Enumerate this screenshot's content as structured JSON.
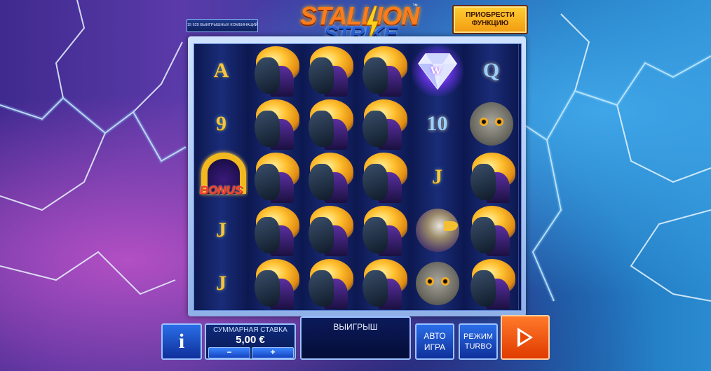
{
  "header": {
    "logo_line1": "STALLION",
    "logo_line2": "STRIKE",
    "logo_tm": "™",
    "ways_text": "15 625 ВЫИГРЫШНЫХ КОМБИНАЦИЙ",
    "buy_feature_label": "ПРИОБРЕСТИ ФУНКЦИЮ"
  },
  "reels": [
    {
      "symbols": [
        {
          "type": "card",
          "text": "A"
        },
        {
          "type": "card",
          "text": "9"
        },
        {
          "type": "bonus",
          "text": "BONUS"
        },
        {
          "type": "card",
          "text": "J"
        },
        {
          "type": "card",
          "text": "J"
        }
      ]
    },
    {
      "symbols": [
        {
          "type": "horse"
        },
        {
          "type": "horse"
        },
        {
          "type": "horse"
        },
        {
          "type": "horse"
        },
        {
          "type": "horse"
        }
      ]
    },
    {
      "symbols": [
        {
          "type": "horse"
        },
        {
          "type": "horse"
        },
        {
          "type": "horse"
        },
        {
          "type": "horse"
        },
        {
          "type": "horse"
        }
      ]
    },
    {
      "symbols": [
        {
          "type": "horse"
        },
        {
          "type": "horse"
        },
        {
          "type": "horse"
        },
        {
          "type": "horse"
        },
        {
          "type": "horse"
        }
      ]
    },
    {
      "symbols": [
        {
          "type": "diamond",
          "text": "W"
        },
        {
          "type": "card",
          "text": "10"
        },
        {
          "type": "card",
          "text": "J"
        },
        {
          "type": "eagle"
        },
        {
          "type": "owl"
        }
      ]
    },
    {
      "symbols": [
        {
          "type": "card",
          "text": "Q"
        },
        {
          "type": "owl"
        },
        {
          "type": "horse"
        },
        {
          "type": "horse"
        },
        {
          "type": "horse"
        }
      ]
    }
  ],
  "controls": {
    "info_label": "i",
    "bet_label": "СУММАРНАЯ СТАВКА",
    "bet_value": "5,00 €",
    "minus_label": "−",
    "plus_label": "+",
    "win_label": "ВЫИГРЫШ",
    "auto_line1": "АВТО",
    "auto_line2": "ИГРА",
    "turbo_line1": "РЕЖИМ",
    "turbo_line2": "TURBO"
  },
  "colors": {
    "accent_gold": "#f4c542",
    "spin_orange": "#e84a00",
    "button_blue": "#2a6ee8"
  }
}
